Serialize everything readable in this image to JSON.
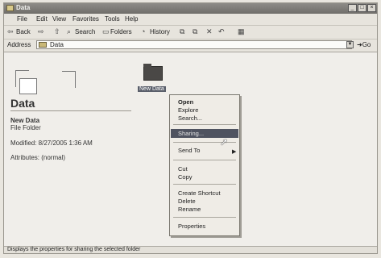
{
  "window": {
    "title": "Data"
  },
  "titlebar_buttons": [
    "_",
    "□",
    "×"
  ],
  "menu": [
    "File",
    "Edit",
    "View",
    "Favorites",
    "Tools",
    "Help"
  ],
  "toolbar": {
    "back": "Back",
    "search": "Search",
    "folders": "Folders",
    "history": "History"
  },
  "address": {
    "label": "Address",
    "value": "Data",
    "go": "Go"
  },
  "panel": {
    "title": "Data",
    "selected_name": "New Data",
    "selected_type": "File Folder",
    "modified": "Modified: 8/27/2005 1:36 AM",
    "attributes": "Attributes: (normal)"
  },
  "folder": {
    "label": "New Data"
  },
  "context_menu": {
    "open": "Open",
    "explore": "Explore",
    "search": "Search...",
    "sharing": "Sharing...",
    "send_to": "Send To",
    "cut": "Cut",
    "copy": "Copy",
    "create_shortcut": "Create Shortcut",
    "delete": "Delete",
    "rename": "Rename",
    "properties": "Properties"
  },
  "status": {
    "text": "Displays the properties for sharing the selected folder"
  },
  "icons": [
    "folder-icon",
    "back-icon",
    "forward-icon",
    "up-icon",
    "search-icon",
    "folders-icon",
    "history-icon",
    "move-to-icon",
    "copy-to-icon",
    "delete-icon",
    "undo-icon",
    "views-icon",
    "go-icon"
  ]
}
